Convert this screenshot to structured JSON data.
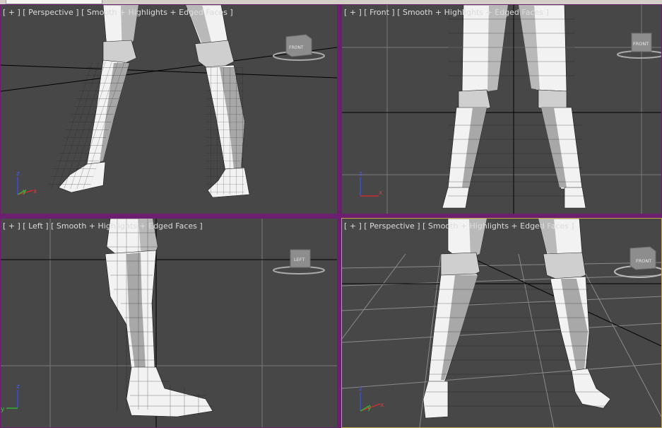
{
  "viewports": {
    "top_left": {
      "menu": "[ + ]",
      "view": "[ Perspective ]",
      "shading": "[ Smooth + Highlights + Edged Faces ]",
      "cube_face": "FRONT",
      "axis_x": "x",
      "axis_y": "y",
      "axis_z": "z"
    },
    "top_right": {
      "menu": "[ + ]",
      "view": "[ Front ]",
      "shading": "[ Smooth + Highlights + Edged Faces ]",
      "cube_face": "FRONT",
      "axis_x": "x",
      "axis_z": "z"
    },
    "bottom_left": {
      "menu": "[ + ]",
      "view": "[ Left ]",
      "shading": "[ Smooth + Highlights + Edged Faces ]",
      "cube_face": "LEFT",
      "axis_y": "y",
      "axis_z": "z"
    },
    "bottom_right": {
      "menu": "[ + ]",
      "view": "[ Perspective ]",
      "shading": "[ Smooth + Highlights + Edged Faces ]",
      "cube_face": "FRONT",
      "axis_x": "x",
      "axis_y": "y",
      "axis_z": "z"
    }
  },
  "colors": {
    "viewport_bg": "#474747",
    "viewport_border": "#6b1f6e",
    "active_viewport_border": "#c5a34a",
    "grid_line": "#7a7a7a",
    "grid_axis": "#000000",
    "mesh_light": "#f2f2f2",
    "mesh_mid": "#b9b9b9",
    "mesh_dark": "#8e8e8e",
    "mesh_edge": "#1a1a1a"
  }
}
